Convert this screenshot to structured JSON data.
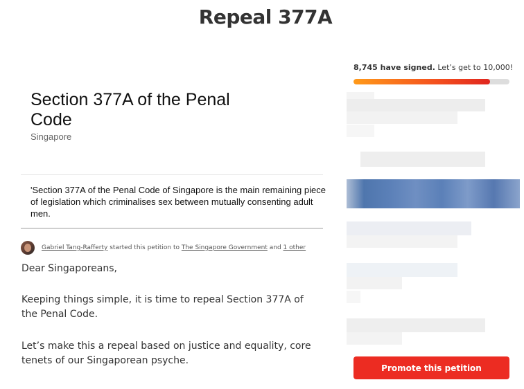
{
  "page": {
    "title": "Repeal 377A"
  },
  "card": {
    "title": "Section 377A of the Penal Code",
    "location": "Singapore",
    "excerpt": "'Section 377A of the Penal Code of Singapore is the main remaining piece of legislation which criminalises sex between mutually consenting adult men."
  },
  "starter": {
    "name": "Gabriel Tang-Rafferty",
    "middle_text": " started this petition to ",
    "target": "The Singapore Government",
    "and_text": " and ",
    "others": "1 other"
  },
  "body": {
    "paragraphs": [
      "Dear Singaporeans,",
      "Keeping things simple, it is time to repeal Section 377A of the Penal Code.",
      "Let’s make this a repeal based on justice and equality, core tenets of our Singaporean psyche."
    ]
  },
  "sidebar": {
    "signed_count": "8,745 have signed.",
    "goal_text": " Let’s get to 10,000!",
    "progress_fraction": 0.8745,
    "promote_label": "Promote this petition"
  },
  "colors": {
    "accent_red": "#ec2c22",
    "progress_start": "#ff9a1a",
    "progress_end": "#e0261f"
  }
}
